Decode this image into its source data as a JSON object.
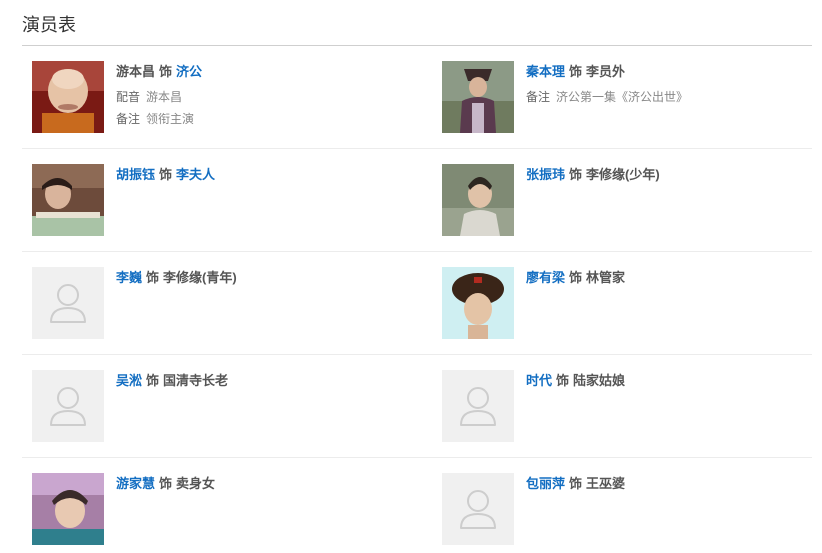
{
  "section_title": "演员表",
  "cast_separator": "饰",
  "cast": [
    {
      "actor": "游本昌",
      "role": "济公",
      "actor_linked": false,
      "role_linked": true,
      "meta": [
        {
          "label": "配音",
          "value": "游本昌"
        },
        {
          "label": "备注",
          "value": "领衔主演"
        }
      ]
    },
    {
      "actor": "秦本理",
      "role": "李员外",
      "actor_linked": true,
      "role_linked": false,
      "meta": [
        {
          "label": "备注",
          "value": "济公第一集《济公出世》"
        }
      ]
    },
    {
      "actor": "胡振钰",
      "role": "李夫人",
      "actor_linked": true,
      "role_linked": true,
      "meta": []
    },
    {
      "actor": "张振玮",
      "role": "李修缘(少年)",
      "actor_linked": true,
      "role_linked": false,
      "meta": []
    },
    {
      "actor": "李巍",
      "role": "李修缘(青年)",
      "actor_linked": true,
      "role_linked": false,
      "meta": []
    },
    {
      "actor": "廖有梁",
      "role": "林管家",
      "actor_linked": true,
      "role_linked": false,
      "meta": []
    },
    {
      "actor": "吴淞",
      "role": "国清寺长老",
      "actor_linked": true,
      "role_linked": false,
      "meta": []
    },
    {
      "actor": "时代",
      "role": "陆家姑娘",
      "actor_linked": true,
      "role_linked": false,
      "meta": []
    },
    {
      "actor": "游家慧",
      "role": "卖身女",
      "actor_linked": true,
      "role_linked": false,
      "meta": []
    },
    {
      "actor": "包丽萍",
      "role": "王巫婆",
      "actor_linked": true,
      "role_linked": false,
      "meta": []
    }
  ]
}
